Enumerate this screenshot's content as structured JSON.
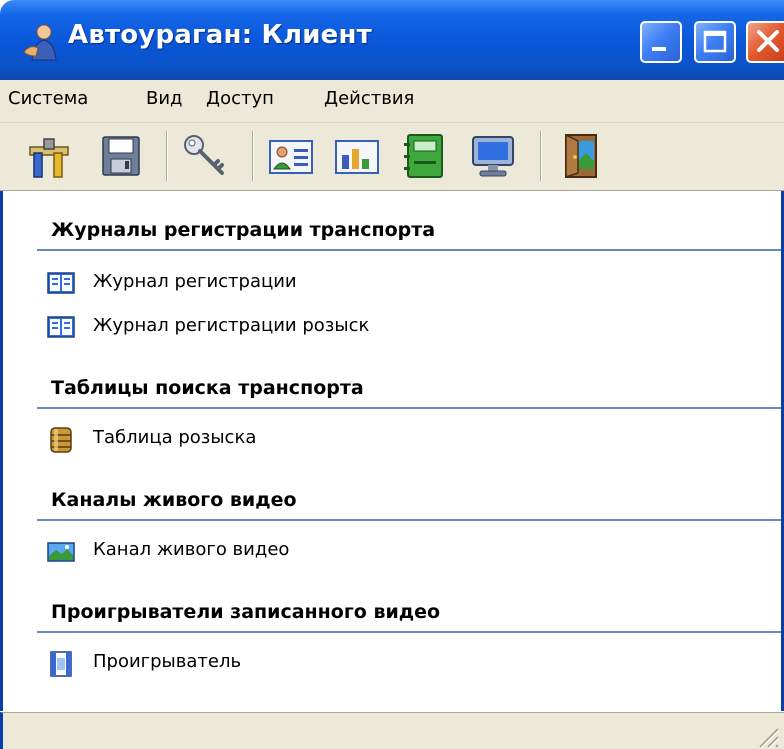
{
  "window": {
    "title": "Автоураган: Клиент"
  },
  "menu": {
    "items": [
      "Система",
      "Вид",
      "Доступ",
      "Действия"
    ]
  },
  "toolbar": {
    "icons": [
      "settings-icon",
      "save-icon",
      "key-icon",
      "user-card-icon",
      "chart-icon",
      "address-book-icon",
      "monitor-icon",
      "exit-door-icon"
    ]
  },
  "sections": [
    {
      "title": "Журналы регистрации транспорта",
      "items": [
        {
          "label": "Журнал регистрации",
          "icon": "book-icon"
        },
        {
          "label": "Журнал регистрации розыск",
          "icon": "book-icon"
        }
      ]
    },
    {
      "title": "Таблицы поиска транспорта",
      "items": [
        {
          "label": "Таблица розыска",
          "icon": "database-icon"
        }
      ]
    },
    {
      "title": "Каналы живого видео",
      "items": [
        {
          "label": "Канал живого видео",
          "icon": "landscape-icon"
        }
      ]
    },
    {
      "title": "Проигрыватели записанного видео",
      "items": [
        {
          "label": "Проигрыватель",
          "icon": "film-icon"
        }
      ]
    }
  ],
  "colors": {
    "titlebar": "#0a56d8",
    "chrome": "#ece9d8",
    "section_line": "#6a86c8"
  }
}
